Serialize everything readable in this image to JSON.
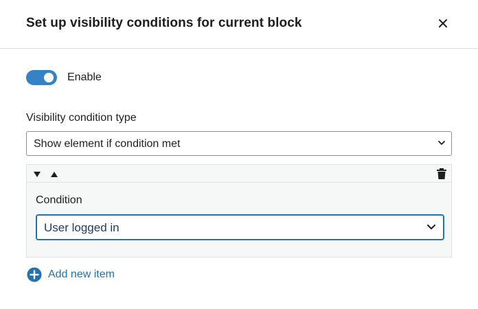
{
  "modal": {
    "title": "Set up visibility conditions for current block",
    "close_icon": "close-icon"
  },
  "enable": {
    "label": "Enable",
    "checked": true,
    "color": "#3582c4"
  },
  "visibility_type": {
    "label": "Visibility condition type",
    "value": "Show element if condition met"
  },
  "repeater": {
    "items": [
      {
        "condition_label": "Condition",
        "condition_value": "User logged in"
      }
    ]
  },
  "add_item": {
    "label": "Add new item",
    "color": "#2271b1"
  }
}
